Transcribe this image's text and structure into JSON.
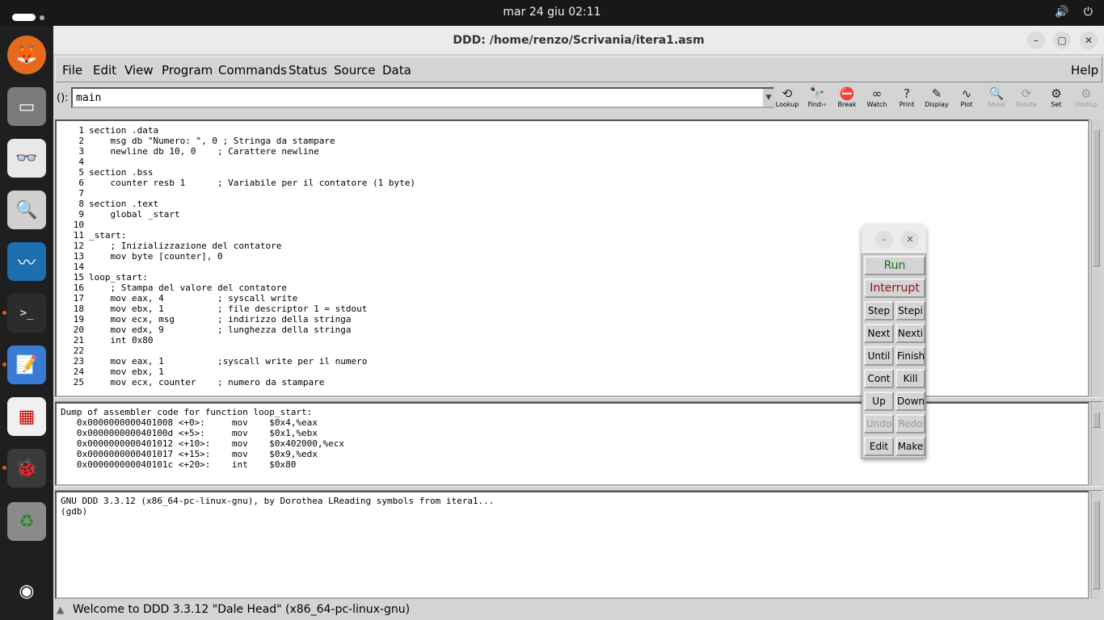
{
  "topbar": {
    "clock": "mar 24 giu  02:11",
    "tray_volume_icon": "🔊",
    "tray_power_icon": "⏻"
  },
  "window": {
    "title": "DDD: /home/renzo/Scrivania/itera1.asm"
  },
  "menubar": {
    "items": [
      "File",
      "Edit",
      "View",
      "Program",
      "Commands",
      "Status",
      "Source",
      "Data"
    ],
    "help": "Help"
  },
  "toolbar": {
    "arg_label": "():",
    "arg_value": "main",
    "tools": [
      {
        "label": "Lookup",
        "icon": "⟲",
        "enabled": true
      },
      {
        "label": "Find››",
        "icon": "🔭",
        "enabled": true
      },
      {
        "label": "Break",
        "icon": "⛔",
        "enabled": true
      },
      {
        "label": "Watch",
        "icon": "∞",
        "enabled": true
      },
      {
        "label": "Print",
        "icon": "?",
        "enabled": true
      },
      {
        "label": "Display",
        "icon": "✎",
        "enabled": true
      },
      {
        "label": "Plot",
        "icon": "∿",
        "enabled": true
      },
      {
        "label": "Show",
        "icon": "🔍",
        "enabled": false
      },
      {
        "label": "Rotate",
        "icon": "⟳",
        "enabled": false
      },
      {
        "label": "Set",
        "icon": "⚙",
        "enabled": true
      },
      {
        "label": "Undisp",
        "icon": "⚙",
        "enabled": false
      }
    ]
  },
  "source": {
    "lines": [
      {
        "n": "1",
        "t": "section .data"
      },
      {
        "n": "2",
        "t": "    msg db \"Numero: \", 0 ; Stringa da stampare"
      },
      {
        "n": "3",
        "t": "    newline db 10, 0    ; Carattere newline"
      },
      {
        "n": "4",
        "t": ""
      },
      {
        "n": "5",
        "t": "section .bss"
      },
      {
        "n": "6",
        "t": "    counter resb 1      ; Variabile per il contatore (1 byte)"
      },
      {
        "n": "7",
        "t": ""
      },
      {
        "n": "8",
        "t": "section .text"
      },
      {
        "n": "9",
        "t": "    global _start"
      },
      {
        "n": "10",
        "t": ""
      },
      {
        "n": "11",
        "t": "_start:"
      },
      {
        "n": "12",
        "t": "    ; Inizializzazione del contatore"
      },
      {
        "n": "13",
        "t": "    mov byte [counter], 0"
      },
      {
        "n": "14",
        "t": ""
      },
      {
        "n": "15",
        "t": "loop_start:"
      },
      {
        "n": "16",
        "t": "    ; Stampa del valore del contatore"
      },
      {
        "n": "17",
        "t": "    mov eax, 4          ; syscall write"
      },
      {
        "n": "18",
        "t": "    mov ebx, 1          ; file descriptor 1 = stdout"
      },
      {
        "n": "19",
        "t": "    mov ecx, msg        ; indirizzo della stringa"
      },
      {
        "n": "20",
        "t": "    mov edx, 9          ; lunghezza della stringa"
      },
      {
        "n": "21",
        "t": "    int 0x80"
      },
      {
        "n": "22",
        "t": ""
      },
      {
        "n": "23",
        "t": "    mov eax, 1          ;syscall write per il numero"
      },
      {
        "n": "24",
        "t": "    mov ebx, 1"
      },
      {
        "n": "25",
        "t": "    mov ecx, counter    ; numero da stampare"
      }
    ]
  },
  "assembler": {
    "lines": [
      "Dump of assembler code for function loop_start:",
      "   0x0000000000401008 <+0>:     mov    $0x4,%eax",
      "   0x000000000040100d <+5>:     mov    $0x1,%ebx",
      "   0x0000000000401012 <+10>:    mov    $0x402000,%ecx",
      "   0x0000000000401017 <+15>:    mov    $0x9,%edx",
      "   0x000000000040101c <+20>:    int    $0x80"
    ]
  },
  "console": {
    "lines": [
      "GNU DDD 3.3.12 (x86_64-pc-linux-gnu), by Dorothea LReading symbols from itera1...",
      "(gdb) "
    ]
  },
  "statusbar": {
    "message": "Welcome to DDD 3.3.12 \"Dale Head\" (x86_64-pc-linux-gnu)"
  },
  "command_tool": {
    "run": "Run",
    "interrupt": "Interrupt",
    "rows": [
      [
        "Step",
        "Stepi"
      ],
      [
        "Next",
        "Nexti"
      ],
      [
        "Until",
        "Finish"
      ],
      [
        "Cont",
        "Kill"
      ],
      [
        "Up",
        "Down"
      ],
      [
        "Undo",
        "Redo"
      ],
      [
        "Edit",
        "Make"
      ]
    ],
    "disabled": [
      "Undo",
      "Redo"
    ]
  }
}
